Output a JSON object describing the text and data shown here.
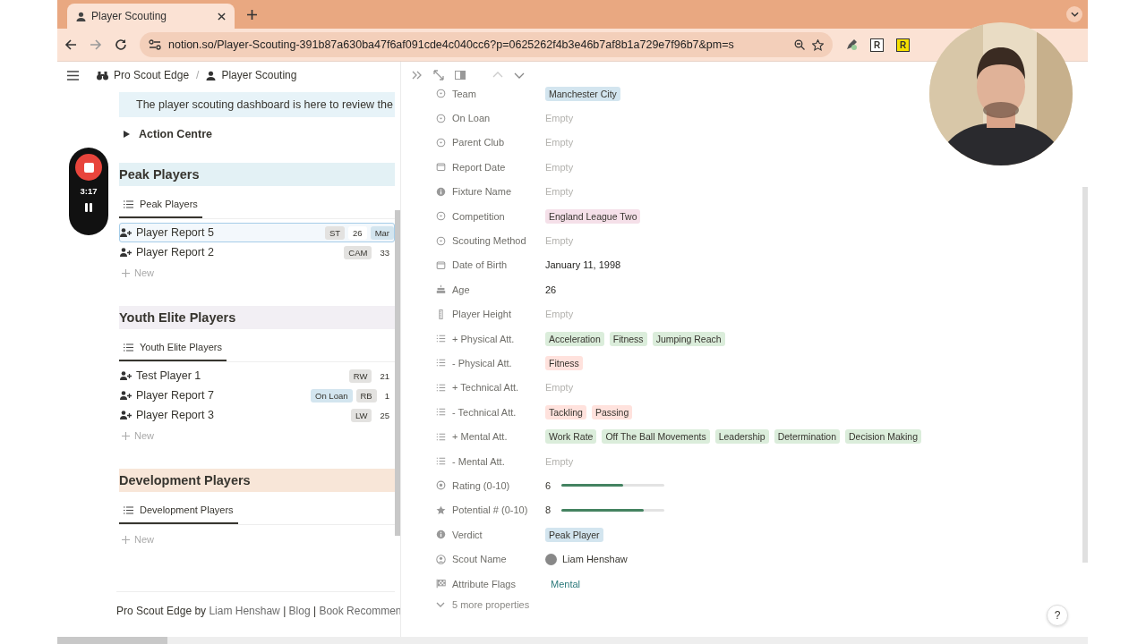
{
  "browser": {
    "tab": {
      "title": "Player Scouting",
      "selected": true
    },
    "url": "notion.so/Player-Scouting-391b87a630ba47f6af091cde4c040cc6?p=0625262f4b3e46b7af8b1a729e7f96b7&pm=s",
    "extensions": [
      "R",
      "R"
    ]
  },
  "recorder": {
    "time": "3:17"
  },
  "breadcrumb": [
    "Pro Scout Edge",
    "Player Scouting"
  ],
  "breadcrumb_separator": "/",
  "callout": "The player scouting dashboard is here to review the",
  "toggle": {
    "label": "Action Centre",
    "expanded": false
  },
  "sections": [
    {
      "title": "Peak Players",
      "color": "#e3f1f5",
      "view": "Peak Players",
      "rows": [
        {
          "name": "Player Report 5",
          "selected": true,
          "tags": [
            {
              "label": "ST",
              "color": "#e3e2e0"
            },
            {
              "label": "26",
              "color": "#ffffff"
            },
            {
              "label": "Mar",
              "color": "#d3e5ef"
            }
          ]
        },
        {
          "name": "Player Report 2",
          "selected": false,
          "tags": [
            {
              "label": "CAM",
              "color": "#e3e2e0"
            },
            {
              "label": "33",
              "color": "#ffffff"
            }
          ]
        }
      ],
      "new": "New"
    },
    {
      "title": "Youth Elite Players",
      "color": "#f2eff4",
      "view": "Youth Elite Players",
      "rows": [
        {
          "name": "Test Player 1",
          "selected": false,
          "tags": [
            {
              "label": "RW",
              "color": "#e3e2e0"
            },
            {
              "label": "21",
              "color": "#ffffff"
            }
          ]
        },
        {
          "name": "Player Report 7",
          "selected": false,
          "tags": [
            {
              "label": "On Loan",
              "color": "#d3e5ef"
            },
            {
              "label": "RB",
              "color": "#e3e2e0"
            },
            {
              "label": "1",
              "color": "#ffffff"
            }
          ]
        },
        {
          "name": "Player Report 3",
          "selected": false,
          "tags": [
            {
              "label": "LW",
              "color": "#e3e2e0"
            },
            {
              "label": "25",
              "color": "#ffffff"
            }
          ]
        }
      ],
      "new": "New"
    },
    {
      "title": "Development Players",
      "color": "#f8e6d8",
      "view": "Development Players",
      "new": "New"
    }
  ],
  "footer": {
    "lead": "Pro Scout Edge by",
    "separator": "|",
    "links": [
      "Liam Henshaw",
      "Blog",
      "Book Recommen"
    ]
  },
  "help": "?",
  "properties": [
    {
      "label": "Team",
      "kind": "select",
      "tags": [
        {
          "label": "Manchester City",
          "color": "#d3e5ef"
        }
      ]
    },
    {
      "label": "On Loan",
      "kind": "select",
      "value": "Empty",
      "empty": true
    },
    {
      "label": "Parent Club",
      "kind": "select",
      "value": "Empty",
      "empty": true
    },
    {
      "label": "Report Date",
      "kind": "date",
      "value": "Empty",
      "empty": true
    },
    {
      "label": "Fixture Name",
      "kind": "info",
      "value": "Empty",
      "empty": true
    },
    {
      "label": "Competition",
      "kind": "select",
      "tags": [
        {
          "label": "England League Two",
          "color": "#f5e0e9"
        }
      ]
    },
    {
      "label": "Scouting Method",
      "kind": "select",
      "value": "Empty",
      "empty": true
    },
    {
      "label": "Date of Birth",
      "kind": "date",
      "value": "January 11, 1998"
    },
    {
      "label": "Age",
      "kind": "formula",
      "value": "26"
    },
    {
      "label": "Player Height",
      "kind": "number",
      "value": "Empty",
      "empty": true
    },
    {
      "label": "+ Physical Att.",
      "kind": "multi_select",
      "tags": [
        {
          "label": "Acceleration",
          "color": "#dbeddb"
        },
        {
          "label": "Fitness",
          "color": "#dbeddb"
        },
        {
          "label": "Jumping Reach",
          "color": "#dbeddb"
        }
      ]
    },
    {
      "label": "- Physical Att.",
      "kind": "multi_select",
      "tags": [
        {
          "label": "Fitness",
          "color": "#ffe2dd"
        }
      ]
    },
    {
      "label": "+ Technical Att.",
      "kind": "multi_select",
      "value": "Empty",
      "empty": true
    },
    {
      "label": "- Technical Att.",
      "kind": "multi_select",
      "tags": [
        {
          "label": "Tackling",
          "color": "#ffe2dd"
        },
        {
          "label": "Passing",
          "color": "#ffe2dd"
        }
      ]
    },
    {
      "label": "+ Mental Att.",
      "kind": "multi_select",
      "tags": [
        {
          "label": "Work Rate",
          "color": "#dbeddb"
        },
        {
          "label": "Off The Ball Movements",
          "color": "#dbeddb"
        },
        {
          "label": "Leadership",
          "color": "#dbeddb"
        },
        {
          "label": "Determination",
          "color": "#dbeddb"
        },
        {
          "label": "Decision Making",
          "color": "#dbeddb"
        }
      ]
    },
    {
      "label": "- Mental Att.",
      "kind": "multi_select",
      "value": "Empty",
      "empty": true
    },
    {
      "label": "Rating (0-10)",
      "kind": "rating",
      "value": "6",
      "level": 0.6
    },
    {
      "label": "Potential # (0-10)",
      "kind": "star",
      "value": "8",
      "level": 0.8
    },
    {
      "label": "Verdict",
      "kind": "info",
      "tags": [
        {
          "label": "Peak Player",
          "color": "#d3e5ef"
        }
      ]
    },
    {
      "label": "Scout Name",
      "kind": "person",
      "value": "Liam Henshaw"
    },
    {
      "label": "Attribute Flags",
      "kind": "flags",
      "value": "Mental"
    }
  ],
  "more": "5 more properties"
}
